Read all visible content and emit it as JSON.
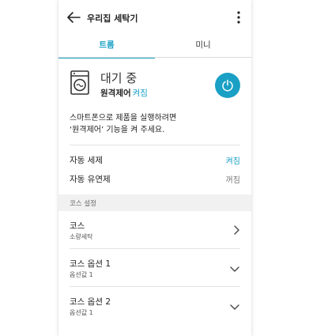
{
  "header": {
    "title": "우리집 세탁기",
    "icons": {
      "back": "arrow-left-icon",
      "more": "more-vertical-icon"
    }
  },
  "tabs": [
    {
      "label": "트롬",
      "active": true
    },
    {
      "label": "미니",
      "active": false
    }
  ],
  "device": {
    "icon": "washing-machine-icon",
    "status": "대기 중",
    "remote_label": "원격제어",
    "remote_state": "켜짐",
    "power_icon": "power-icon"
  },
  "notice": {
    "line1": "스마트폰으로 제품을 실행하려면",
    "line2": "‘원격제어’ 기능을 켜 주세요."
  },
  "settings": [
    {
      "label": "자동 세제",
      "value": "켜짐",
      "state": "on"
    },
    {
      "label": "자동 유연제",
      "value": "꺼짐",
      "state": "off"
    }
  ],
  "course_section": {
    "header": "코스 설정",
    "items": [
      {
        "title": "코스",
        "subtitle": "소량세탁",
        "icon": "chevron-right-icon"
      },
      {
        "title": "코스 옵션 1",
        "subtitle": "옵션값 1",
        "icon": "chevron-down-icon"
      },
      {
        "title": "코스 옵션 2",
        "subtitle": "옵션값 1",
        "icon": "chevron-down-icon"
      }
    ]
  },
  "colors": {
    "accent": "#1aa0c4",
    "text": "#222222",
    "muted": "#777777",
    "section_bg": "#f1f1f1",
    "divider": "#e3e3e3"
  }
}
